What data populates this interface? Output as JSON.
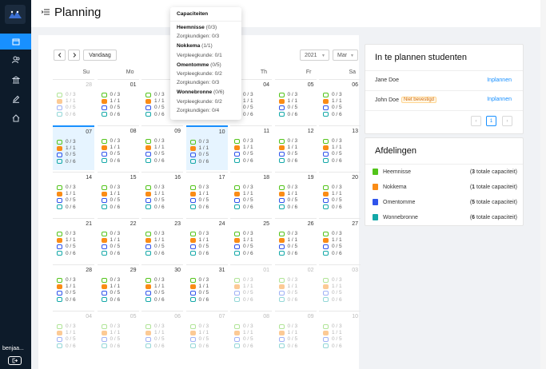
{
  "user": {
    "name": "benjaa..."
  },
  "header": {
    "title": "Planning"
  },
  "toolbar": {
    "today_label": "Vandaag",
    "year": "2021",
    "month": "Mar"
  },
  "weekdays": [
    "Su",
    "Mo",
    "Tu",
    "We",
    "Th",
    "Fr",
    "Sa"
  ],
  "colors": {
    "Heemnisse": "#52c41a",
    "Nokkema": "#fa8c16",
    "Omentomme": "#2f54eb",
    "Wonnebronne": "#13a8a8",
    "accent": "#1890ff"
  },
  "caps": {
    "a": [
      "0 / 3",
      "1 / 1",
      "0 / 5",
      "0 / 6"
    ],
    "b": [
      "0 / 3",
      "1 / 1",
      "0 / 5",
      "0 / 6"
    ]
  },
  "calendar": {
    "rows": [
      [
        "28",
        "01",
        "02",
        "03",
        "04",
        "05",
        "06"
      ],
      [
        "07",
        "08",
        "09",
        "10",
        "11",
        "12",
        "13"
      ],
      [
        "14",
        "15",
        "16",
        "17",
        "18",
        "19",
        "20"
      ],
      [
        "21",
        "22",
        "23",
        "24",
        "25",
        "26",
        "27"
      ],
      [
        "28",
        "29",
        "30",
        "31",
        "01",
        "02",
        "03"
      ],
      [
        "04",
        "05",
        "06",
        "07",
        "08",
        "09",
        "10"
      ]
    ]
  },
  "tooltip": {
    "title": "Capaciteiten",
    "lines": [
      {
        "name": "Heemnisse",
        "count": "(0/3)"
      },
      {
        "text": "Zorgkundigen: 0/3"
      },
      {
        "name": "Nokkema",
        "count": "(1/1)"
      },
      {
        "text": "Verpleegkunde: 0/1"
      },
      {
        "name": "Omentomme",
        "count": "(0/5)"
      },
      {
        "text": "Verpleegkunde: 0/2"
      },
      {
        "text": "Zorgkundigen: 0/3"
      },
      {
        "name": "Wonnebronne",
        "count": "(0/6)"
      },
      {
        "text": "Verpleegkunde: 0/2"
      },
      {
        "text": "Zorgkundigen: 0/4"
      }
    ]
  },
  "students": {
    "title": "In te plannen studenten",
    "items": [
      {
        "name": "Jane Doe",
        "badge": "",
        "action": "Inplannen"
      },
      {
        "name": "John Doe",
        "badge": "Niet bevestigd",
        "action": "Inplannen"
      }
    ],
    "page": "1"
  },
  "afdelingen": {
    "title": "Afdelingen",
    "items": [
      {
        "name": "Heemnisse",
        "cap_num": "3",
        "cap_text": " totale capaciteit)"
      },
      {
        "name": "Nokkema",
        "cap_num": "1",
        "cap_text": " totale capaciteit)"
      },
      {
        "name": "Omentomme",
        "cap_num": "5",
        "cap_text": " totale capaciteit)"
      },
      {
        "name": "Wonnebronne",
        "cap_num": "6",
        "cap_text": " totale capaciteit)"
      }
    ]
  }
}
